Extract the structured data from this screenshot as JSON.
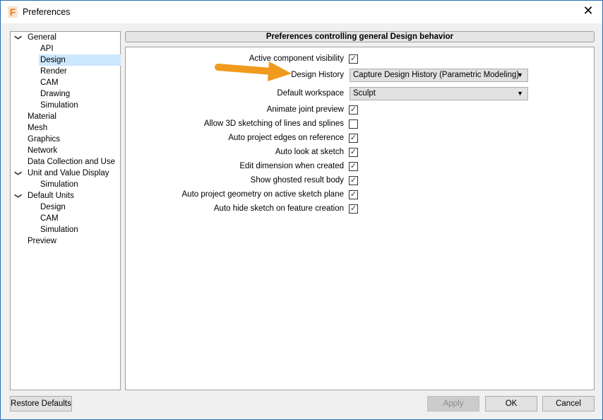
{
  "window": {
    "title": "Preferences",
    "logo": "F",
    "close": "✕"
  },
  "tree": [
    {
      "label": "General",
      "level": 0,
      "expanded": true
    },
    {
      "label": "API",
      "level": 1
    },
    {
      "label": "Design",
      "level": 1,
      "selected": true
    },
    {
      "label": "Render",
      "level": 1
    },
    {
      "label": "CAM",
      "level": 1
    },
    {
      "label": "Drawing",
      "level": 1
    },
    {
      "label": "Simulation",
      "level": 1
    },
    {
      "label": "Material",
      "level": 0
    },
    {
      "label": "Mesh",
      "level": 0
    },
    {
      "label": "Graphics",
      "level": 0
    },
    {
      "label": "Network",
      "level": 0
    },
    {
      "label": "Data Collection and Use",
      "level": 0
    },
    {
      "label": "Unit and Value Display",
      "level": 0,
      "expanded": true
    },
    {
      "label": "Simulation",
      "level": 1
    },
    {
      "label": "Default Units",
      "level": 0,
      "expanded": true
    },
    {
      "label": "Design",
      "level": 1
    },
    {
      "label": "CAM",
      "level": 1
    },
    {
      "label": "Simulation",
      "level": 1
    },
    {
      "label": "Preview",
      "level": 0
    }
  ],
  "header": "Preferences controlling general Design behavior",
  "settings": [
    {
      "label": "Active component visibility",
      "type": "checkbox",
      "checked": true
    },
    {
      "label": "Design History",
      "type": "dropdown",
      "value": "Capture Design History (Parametric Modeling)"
    },
    {
      "label": "Default workspace",
      "type": "dropdown",
      "value": "Sculpt"
    },
    {
      "label": "Animate joint preview",
      "type": "checkbox",
      "checked": true
    },
    {
      "label": "Allow 3D sketching of lines and splines",
      "type": "checkbox",
      "checked": false
    },
    {
      "label": "Auto project edges on reference",
      "type": "checkbox",
      "checked": true
    },
    {
      "label": "Auto look at sketch",
      "type": "checkbox",
      "checked": true
    },
    {
      "label": "Edit dimension when created",
      "type": "checkbox",
      "checked": true
    },
    {
      "label": "Show ghosted result body",
      "type": "checkbox",
      "checked": true
    },
    {
      "label": "Auto project geometry on active sketch plane",
      "type": "checkbox",
      "checked": true
    },
    {
      "label": "Auto hide sketch on feature creation",
      "type": "checkbox",
      "checked": true
    }
  ],
  "buttons": {
    "restore": "Restore Defaults",
    "apply": "Apply",
    "ok": "OK",
    "cancel": "Cancel"
  },
  "colors": {
    "annotation_arrow": "#f09a1e",
    "selection": "#cce8ff"
  }
}
